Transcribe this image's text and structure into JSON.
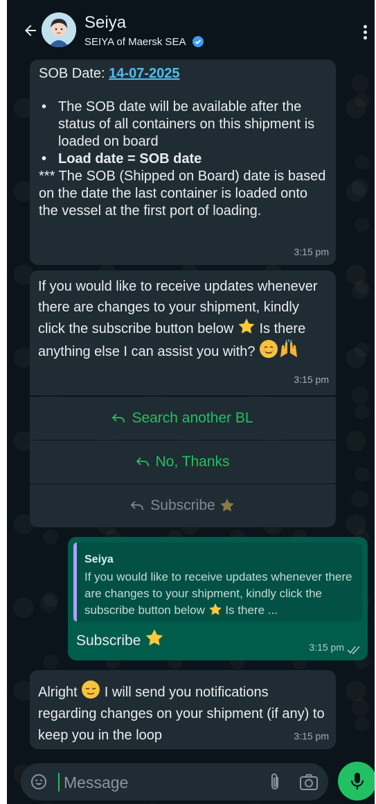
{
  "header": {
    "name": "Seiya",
    "subtitle": "SEIYA of Maersk SEA",
    "icons": [
      "back-arrow-icon",
      "avatar",
      "verified-badge-icon",
      "more-options-icon"
    ]
  },
  "messages": {
    "m1": {
      "sob_label": "SOB Date: ",
      "sob_date": "14-07-2025",
      "bullet1": "The SOB date will be available after the status of all containers on this shipment is loaded on board",
      "bullet2": "Load date = SOB date",
      "note": "*** The SOB (Shipped on Board) date is based on the date the last container is loaded onto the vessel at the first port of loading.",
      "time": "3:15 pm"
    },
    "m2": {
      "text_a": "If you would like to receive updates whenever there are changes to your shipment, kindly click the subscribe button below ",
      "text_b": " Is there anything else I can assist you with? ",
      "time": "3:15 pm",
      "replies": [
        "Search another BL",
        "No, Thanks",
        "Subscribe"
      ]
    },
    "m3": {
      "quote_name": "Seiya",
      "quote_text": "If you would like to receive updates whenever there are changes to your shipment, kindly click the subscribe button below ",
      "quote_tail": " Is there ...",
      "text": "Subscribe",
      "time": "3:15 pm"
    },
    "m4": {
      "text_a": "Alright ",
      "text_b": " I will send you notifications regarding changes on your shipment (if any) to keep you in the loop",
      "time": "3:15 pm"
    }
  },
  "composer": {
    "placeholder": "Message"
  },
  "colors": {
    "background": "#0b141a",
    "incoming_bubble": "#202c33",
    "outgoing_bubble": "#005c4b",
    "accent_green": "#21c063",
    "link_blue": "#53bdeb"
  }
}
